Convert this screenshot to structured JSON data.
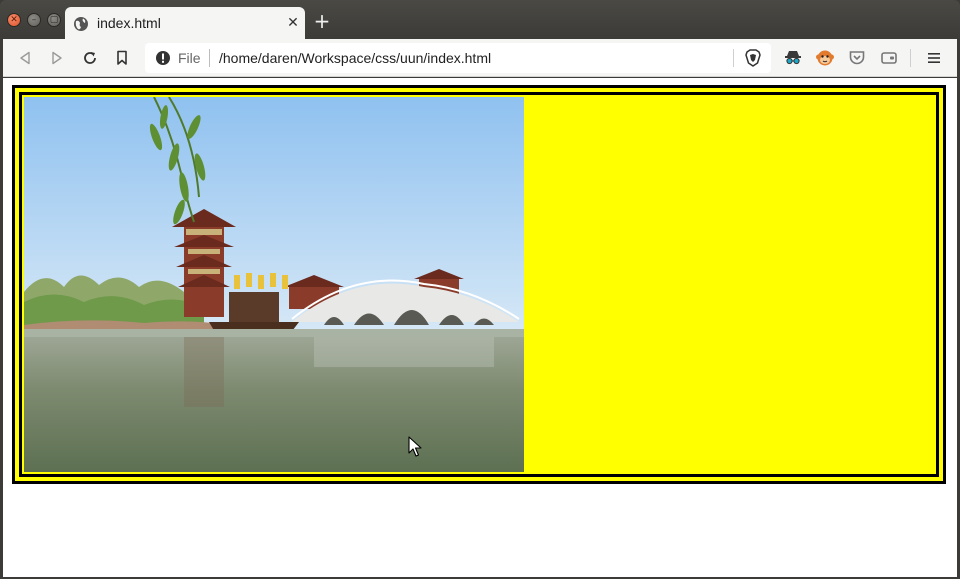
{
  "tab": {
    "title": "index.html",
    "close_glyph": "✕",
    "new_tab_glyph": "+"
  },
  "window_controls": {
    "close_glyph": "✕",
    "minimize_glyph": "–",
    "maximize_glyph": "▢"
  },
  "toolbar": {
    "url_scheme": "File",
    "url_path": "/home/daren/Workspace/css/uun/index.html"
  },
  "icons": {
    "tab_favicon": "globe-icon",
    "back": "back-icon",
    "forward": "forward-icon",
    "reload": "reload-icon",
    "bookmark": "bookmark-icon",
    "site_info": "info-icon",
    "shields": "brave-shield-icon",
    "ext1": "incognito-extension-icon",
    "ext2": "monkey-extension-icon",
    "ext3": "pocket-icon",
    "ext4": "wallet-icon",
    "menu": "hamburger-menu-icon"
  },
  "page": {
    "box_color": "#ffff00",
    "border_color": "#000000",
    "image_subject": "pagoda-lake-bridge-photo"
  }
}
